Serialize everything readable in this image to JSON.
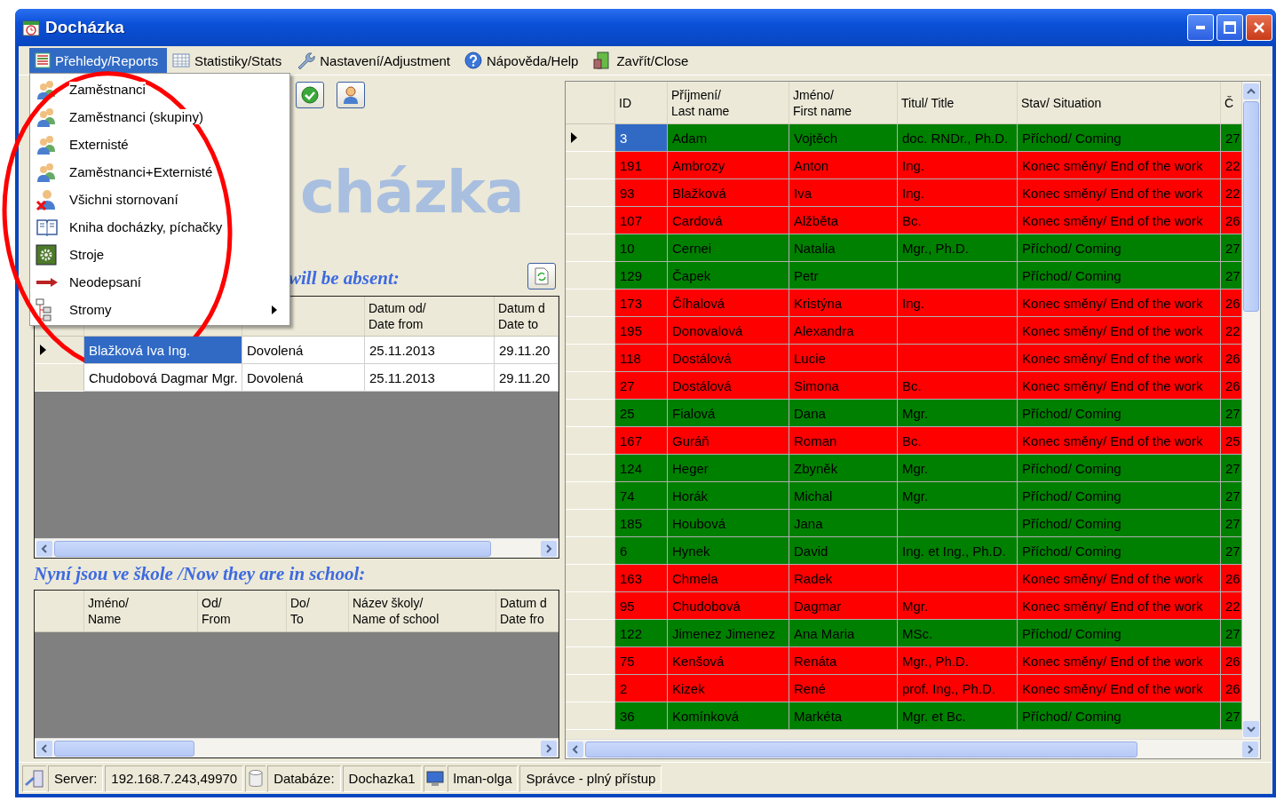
{
  "window": {
    "title": "Docházka"
  },
  "menu_bar": [
    {
      "label": "Přehledy/Reports",
      "selected": true
    },
    {
      "label": "Statistiky/Stats",
      "selected": false
    },
    {
      "label": "Nastavení/Adjustment",
      "selected": false
    },
    {
      "label": "Nápověda/Help",
      "selected": false
    },
    {
      "label": "Zavřít/Close",
      "selected": false
    }
  ],
  "reports_menu": [
    {
      "label": "Zaměstnanci",
      "submenu": false
    },
    {
      "label": "Zaměstnanci (skupiny)",
      "submenu": false
    },
    {
      "label": "Externisté",
      "submenu": false
    },
    {
      "label": "Zaměstnanci+Externisté",
      "submenu": false
    },
    {
      "label": "Všichni stornovaní",
      "submenu": false
    },
    {
      "label": "Kniha docházky, píchačky",
      "submenu": false
    },
    {
      "label": "Stroje",
      "submenu": false
    },
    {
      "label": "Neodepsaní",
      "submenu": false
    },
    {
      "label": "Stromy",
      "submenu": true
    }
  ],
  "logo_text": "cházka",
  "absent_list": {
    "title": "will be absent:",
    "columns": [
      {},
      {},
      {
        "label": "Datum od/\nDate from"
      },
      {
        "label": "Datum d\nDate to"
      }
    ],
    "rows": [
      {
        "selected": true,
        "cells": [
          "Blažková Iva Ing.",
          "Dovolená",
          "25.11.2013",
          "29.11.20"
        ]
      },
      {
        "selected": false,
        "cells": [
          "Chudobová Dagmar Mgr.",
          "Dovolená",
          "25.11.2013",
          "29.11.20"
        ]
      }
    ]
  },
  "school_list": {
    "title": "Nyní jsou ve škole /Now they are in school:",
    "columns": [
      {
        "label": "Jméno/\nName"
      },
      {
        "label": "Od/\nFrom"
      },
      {
        "label": "Do/\nTo"
      },
      {
        "label": "Název školy/\nName of school"
      },
      {
        "label": "Datum d\nDate fro"
      }
    ]
  },
  "employees": {
    "columns": [
      {
        "label": "ID"
      },
      {
        "label": "Příjmení/\nLast name"
      },
      {
        "label": "Jméno/\nFirst name"
      },
      {
        "label": "Titul/ Title"
      },
      {
        "label": "Stav/ Situation"
      },
      {
        "label": "Č"
      }
    ],
    "rows": [
      {
        "color": "#008000",
        "selected": true,
        "cells": [
          "3",
          "Adam",
          "Vojtěch",
          "doc. RNDr., Ph.D.",
          "Příchod/ Coming",
          "27"
        ]
      },
      {
        "color": "#ff0000",
        "selected": false,
        "cells": [
          "191",
          "Ambrozy",
          "Anton",
          "Ing.",
          "Konec směny/ End of the work",
          "22"
        ]
      },
      {
        "color": "#ff0000",
        "selected": false,
        "cells": [
          "93",
          "Blažková",
          "Iva",
          "Ing.",
          "Konec směny/ End of the work",
          "22"
        ]
      },
      {
        "color": "#ff0000",
        "selected": false,
        "cells": [
          "107",
          "Cardová",
          "Alžběta",
          "Bc.",
          "Konec směny/ End of the work",
          "26"
        ]
      },
      {
        "color": "#008000",
        "selected": false,
        "cells": [
          "10",
          "Cernei",
          "Natalia",
          "Mgr., Ph.D.",
          "Příchod/ Coming",
          "27"
        ]
      },
      {
        "color": "#008000",
        "selected": false,
        "cells": [
          "129",
          "Čapek",
          "Petr",
          "",
          "Příchod/ Coming",
          "27"
        ]
      },
      {
        "color": "#ff0000",
        "selected": false,
        "cells": [
          "173",
          "Číhalová",
          "Kristýna",
          "Ing.",
          "Konec směny/ End of the work",
          "26"
        ]
      },
      {
        "color": "#ff0000",
        "selected": false,
        "cells": [
          "195",
          "Donovalová",
          "Alexandra",
          "",
          "Konec směny/ End of the work",
          "22"
        ]
      },
      {
        "color": "#ff0000",
        "selected": false,
        "cells": [
          "118",
          "Dostálová",
          "Lucie",
          "",
          "Konec směny/ End of the work",
          "26"
        ]
      },
      {
        "color": "#ff0000",
        "selected": false,
        "cells": [
          "27",
          "Dostálová",
          "Simona",
          "Bc.",
          "Konec směny/ End of the work",
          "26"
        ]
      },
      {
        "color": "#008000",
        "selected": false,
        "cells": [
          "25",
          "Fialová",
          "Dana",
          "Mgr.",
          "Příchod/ Coming",
          "27"
        ]
      },
      {
        "color": "#ff0000",
        "selected": false,
        "cells": [
          "167",
          "Guráň",
          "Roman",
          "Bc.",
          "Konec směny/ End of the work",
          "25"
        ]
      },
      {
        "color": "#008000",
        "selected": false,
        "cells": [
          "124",
          "Heger",
          "Zbyněk",
          "Mgr.",
          "Příchod/ Coming",
          "27"
        ]
      },
      {
        "color": "#008000",
        "selected": false,
        "cells": [
          "74",
          "Horák",
          "Michal",
          "Mgr.",
          "Příchod/ Coming",
          "27"
        ]
      },
      {
        "color": "#008000",
        "selected": false,
        "cells": [
          "185",
          "Houbová",
          "Jana",
          "",
          "Příchod/ Coming",
          "27"
        ]
      },
      {
        "color": "#008000",
        "selected": false,
        "cells": [
          "6",
          "Hynek",
          "David",
          "Ing. et Ing.,  Ph.D.",
          "Příchod/ Coming",
          "27"
        ]
      },
      {
        "color": "#ff0000",
        "selected": false,
        "cells": [
          "163",
          "Chmela",
          "Radek",
          "",
          "Konec směny/ End of the work",
          "26"
        ]
      },
      {
        "color": "#ff0000",
        "selected": false,
        "cells": [
          "95",
          "Chudobová",
          "Dagmar",
          "Mgr.",
          "Konec směny/ End of the work",
          "22"
        ]
      },
      {
        "color": "#008000",
        "selected": false,
        "cells": [
          "122",
          "Jimenez Jimenez",
          "Ana Maria",
          "MSc.",
          "Příchod/ Coming",
          "27"
        ]
      },
      {
        "color": "#ff0000",
        "selected": false,
        "cells": [
          "75",
          "Kenšová",
          "Renáta",
          "Mgr., Ph.D.",
          "Konec směny/ End of the work",
          "26"
        ]
      },
      {
        "color": "#ff0000",
        "selected": false,
        "cells": [
          "2",
          "Kizek",
          "René",
          "prof. Ing., Ph.D.",
          "Konec směny/ End of the work",
          "26"
        ]
      },
      {
        "color": "#008000",
        "selected": false,
        "cells": [
          "36",
          "Komínková",
          "Markéta",
          "Mgr. et Bc.",
          "Příchod/ Coming",
          "27"
        ]
      }
    ]
  },
  "status_bar": [
    "Server:",
    "192.168.7.243,49970",
    "Databáze:",
    "Dochazka1",
    "lman-olga",
    "Správce - plný přístup"
  ]
}
